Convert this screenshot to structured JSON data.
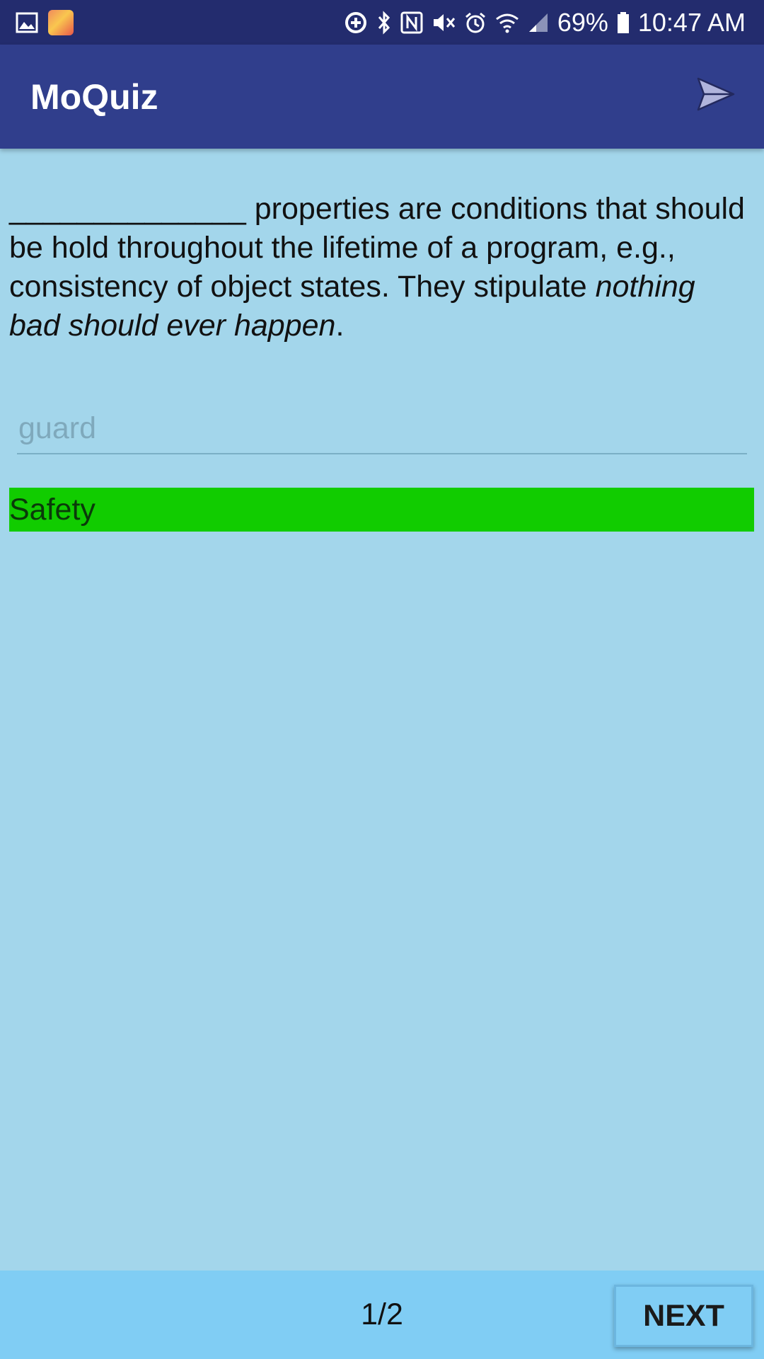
{
  "status_bar": {
    "battery": "69%",
    "time": "10:47 AM",
    "icons_left": [
      "gallery-icon",
      "game-app-icon"
    ],
    "icons_right": [
      "data-saver-icon",
      "bluetooth-icon",
      "nfc-icon",
      "mute-icon",
      "alarm-icon",
      "wifi-icon",
      "signal-icon",
      "battery-icon"
    ]
  },
  "app_bar": {
    "title": "MoQuiz",
    "action_icon": "send-icon"
  },
  "question": {
    "blank": "______________",
    "text_before": " properties are conditions that should be hold throughout the lifetime of a program, e.g., consistency of object states. They stipulate ",
    "emphasis": "nothing bad should ever happen",
    "text_after": "."
  },
  "answer": {
    "placeholder": "guard",
    "value": ""
  },
  "correct_answer": {
    "text": "Safety",
    "color": "#11CC00"
  },
  "footer": {
    "counter": "1/2",
    "next_label": "NEXT"
  },
  "colors": {
    "status_bar": "#232C6E",
    "app_bar": "#303E8C",
    "background": "#A3D6EB",
    "footer": "#80CDF4"
  }
}
